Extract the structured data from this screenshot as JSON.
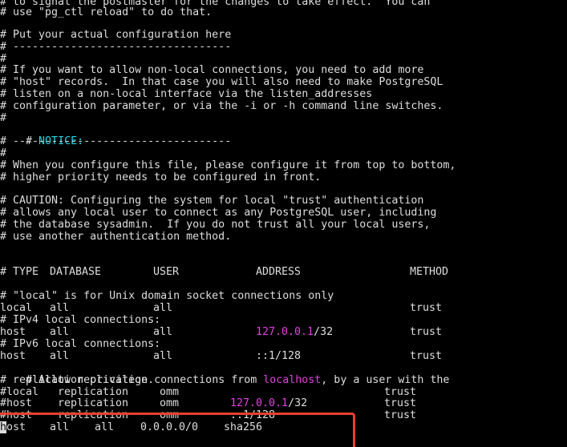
{
  "terminal": {
    "header_lines": [
      "# to signal the postmaster for the changes to take effect.  You can",
      "# use \"pg_ctl reload\" to do that.",
      "",
      "# Put your actual configuration here",
      "# ----------------------------------",
      "#",
      "# If you want to allow non-local connections, you need to add more",
      "# \"host\" records.  In that case you will also need to make PostgreSQL",
      "# listen on a non-local interface via the listen_addresses",
      "# configuration parameter, or via the -i or -h command line switches.",
      "#"
    ],
    "notice_prefix": "# ",
    "notice_word": "NOTICE:",
    "notice_lines": [
      "# ----------------------------------",
      "#",
      "# When you configure this file, please configure it from top to bottom,",
      "# higher priority needs to be configured in front.",
      "",
      "# CAUTION: Configuring the system for local \"trust\" authentication",
      "# allows any local user to connect as any PostgreSQL user, including",
      "# the database sysadmin.  If you do not trust all your local users,",
      "# use another authentication method."
    ],
    "columns_header": {
      "type": "# TYPE",
      "database": "DATABASE",
      "user": "USER",
      "address": "ADDRESS",
      "method": "METHOD"
    },
    "local_comment": "# \"local\" is for Unix domain socket connections only",
    "local_row": {
      "type": "local",
      "database": "all",
      "user": "all",
      "method": "trust"
    },
    "ipv4_comment": "# IPv4 local connections:",
    "ipv4_row": {
      "type": "host",
      "database": "all",
      "user": "all",
      "address_ip": "127.0.0.1",
      "address_mask": "/32",
      "method": "trust"
    },
    "ipv6_comment": "# IPv6 local connections:",
    "ipv6_row": {
      "type": "host",
      "database": "all",
      "user": "all",
      "address": "::1/128",
      "method": "trust"
    },
    "replication_comment_a": "# Allow replication connections from ",
    "replication_comment_host": "localhost",
    "replication_comment_b": ", by a user with the",
    "replication_comment_2": "# replication privilege.",
    "repl_local_row": {
      "type": "#local",
      "database": "replication",
      "user": "omm",
      "method": "trust"
    },
    "repl_host_row": {
      "type": "#host",
      "database": "replication",
      "user": "omm",
      "address_ip": "127.0.0.1",
      "address_mask": "/32",
      "method": "trust"
    },
    "repl_host6_row": {
      "type": "#host",
      "database": "replication",
      "user": "omm",
      "address": "::1/128",
      "method": "trust"
    },
    "new_row": {
      "cursor_char": "h",
      "type_rest": "ost",
      "database": "all",
      "user": "all",
      "address": "0.0.0.0/0",
      "method": "sha256"
    }
  },
  "colors": {
    "background": "#000000",
    "text": "#dedede",
    "ip_highlight": "#e040e0",
    "notice": "#22d3e8",
    "annotation_box": "#e8412c"
  }
}
